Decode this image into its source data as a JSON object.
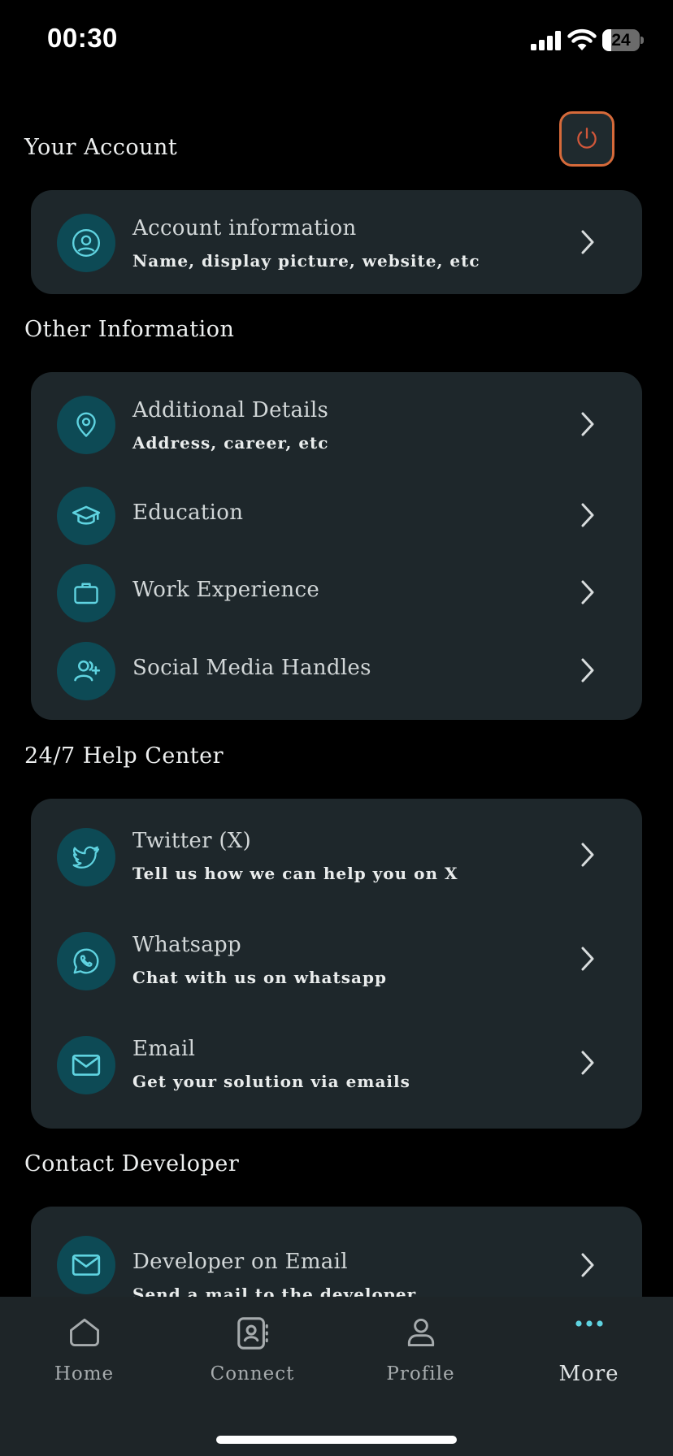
{
  "status_bar": {
    "time": "00:30",
    "battery_level": "24",
    "battery_fraction": 0.24
  },
  "header": {
    "logout_icon": "power-icon",
    "logout_color": "#d66a3a"
  },
  "sections": {
    "account": {
      "title": "Your Account",
      "items": [
        {
          "title": "Account information",
          "subtitle": "Name, display picture, website, etc",
          "icon": "user-circle-icon"
        }
      ]
    },
    "other": {
      "title": "Other Information",
      "items": [
        {
          "title": "Additional Details",
          "subtitle": "Address, career, etc",
          "icon": "location-pin-icon"
        },
        {
          "title": "Education",
          "icon": "graduation-cap-icon"
        },
        {
          "title": "Work Experience",
          "icon": "briefcase-icon"
        },
        {
          "title": "Social Media Handles",
          "icon": "user-plus-icon"
        }
      ]
    },
    "help": {
      "title": "24/7 Help Center",
      "items": [
        {
          "title": "Twitter (X)",
          "subtitle": "Tell us how we can help you on X",
          "icon": "twitter-icon"
        },
        {
          "title": "Whatsapp",
          "subtitle": "Chat with us on whatsapp",
          "icon": "whatsapp-icon"
        },
        {
          "title": "Email",
          "subtitle": "Get your solution via emails",
          "icon": "mail-icon"
        }
      ]
    },
    "developer": {
      "title": "Contact Developer",
      "items": [
        {
          "title": "Developer on Email",
          "subtitle": "Send a mail to the developer",
          "icon": "mail-icon"
        }
      ]
    }
  },
  "tab_bar": {
    "tabs": [
      {
        "label": "Home",
        "icon": "home-icon"
      },
      {
        "label": "Connect",
        "icon": "contacts-book-icon"
      },
      {
        "label": "Profile",
        "icon": "person-icon"
      },
      {
        "label": "More",
        "icon": "more-dots-icon",
        "active": true
      }
    ]
  },
  "colors": {
    "accent": "#5fd3e0",
    "card": "#1e272b",
    "icon_circle": "#0d4a55",
    "background": "#000000"
  }
}
